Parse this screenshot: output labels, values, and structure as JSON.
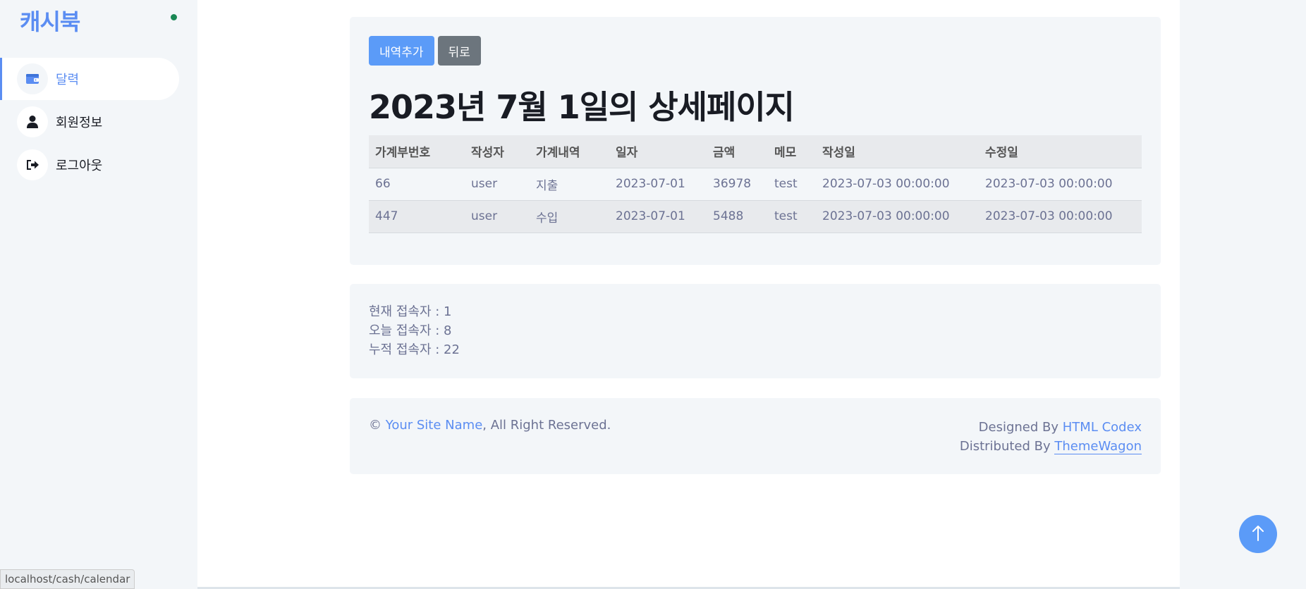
{
  "sidebar": {
    "brand": "캐시북",
    "items": [
      {
        "label": "달력",
        "icon": "wallet-icon",
        "active": true
      },
      {
        "label": "회원정보",
        "icon": "user-icon",
        "active": false
      },
      {
        "label": "로그아웃",
        "icon": "sign-out-icon",
        "active": false
      }
    ]
  },
  "status_url": "localhost/cash/calendar",
  "detail": {
    "add_button": "내역추가",
    "back_button": "뒤로",
    "title": "2023년 7월 1일의 상세페이지",
    "columns": [
      "가계부번호",
      "작성자",
      "가계내역",
      "일자",
      "금액",
      "메모",
      "작성일",
      "수정일"
    ],
    "rows": [
      [
        "66",
        "user",
        "지출",
        "2023-07-01",
        "36978",
        "test",
        "2023-07-03 00:00:00",
        "2023-07-03 00:00:00"
      ],
      [
        "447",
        "user",
        "수입",
        "2023-07-01",
        "5488",
        "test",
        "2023-07-03 00:00:00",
        "2023-07-03 00:00:00"
      ]
    ]
  },
  "stats": {
    "current": "현재 접속자 : 1",
    "today": "오늘 접속자 : 8",
    "total": "누적 접속자 : 22"
  },
  "footer": {
    "copyright_symbol": "©",
    "site_name": "Your Site Name",
    "rights": ", All Right Reserved.",
    "designed_by_label": "Designed By",
    "designed_by_link": "HTML Codex",
    "distributed_by_label": "Distributed By",
    "distributed_by_link": "ThemeWagon"
  },
  "colors": {
    "accent": "#5b8df2",
    "secondary": "#6c757d",
    "panel": "#f3f6f9"
  }
}
